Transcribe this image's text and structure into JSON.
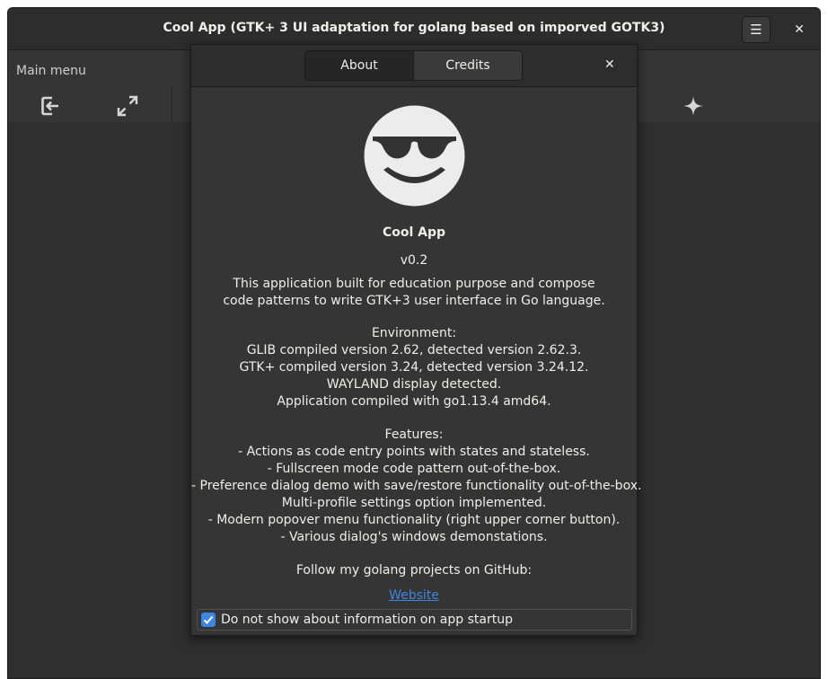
{
  "window": {
    "title": "Cool App (GTK+ 3 UI adaptation for golang based on imporved GOTK3)",
    "menu_button_glyph": "☰",
    "close_glyph": "✕"
  },
  "toolbar": {
    "main_menu_label": "Main menu",
    "icons": [
      "exit-icon",
      "fullscreen-icon",
      "sparkle-icon"
    ]
  },
  "dialog": {
    "tabs": [
      {
        "label": "About",
        "active": true
      },
      {
        "label": "Credits",
        "active": false
      }
    ],
    "close_glyph": "✕",
    "logo_icon": "sunglasses-smiley-icon",
    "app_name": "Cool App",
    "version": "v0.2",
    "description": [
      "This application built for education purpose and compose",
      "code patterns to write GTK+3 user interface in Go language."
    ],
    "environment": [
      "Environment:",
      "GLIB compiled version 2.62, detected version 2.62.3.",
      "GTK+ compiled version 3.24, detected version 3.24.12.",
      "WAYLAND display detected.",
      "Application compiled with go1.13.4 amd64."
    ],
    "features": [
      "Features:",
      "- Actions as code entry points with states and stateless.",
      "- Fullscreen mode code pattern out-of-the-box.",
      "- Preference dialog demo with save/restore functionality out-of-the-box.",
      "Multi-profile settings option implemented.",
      "- Modern popover menu functionality (right upper corner button).",
      "- Various dialog's windows demonstations."
    ],
    "follow_text": "Follow my golang projects on GitHub:",
    "website_link": "Website",
    "startup_checkbox": {
      "label": "Do not show about information on app startup",
      "checked": true
    }
  },
  "colors": {
    "accent": "#3e86e3",
    "window_bg": "#353535",
    "headerbar_bg": "#2d2d2d",
    "text": "#eeeeec"
  }
}
